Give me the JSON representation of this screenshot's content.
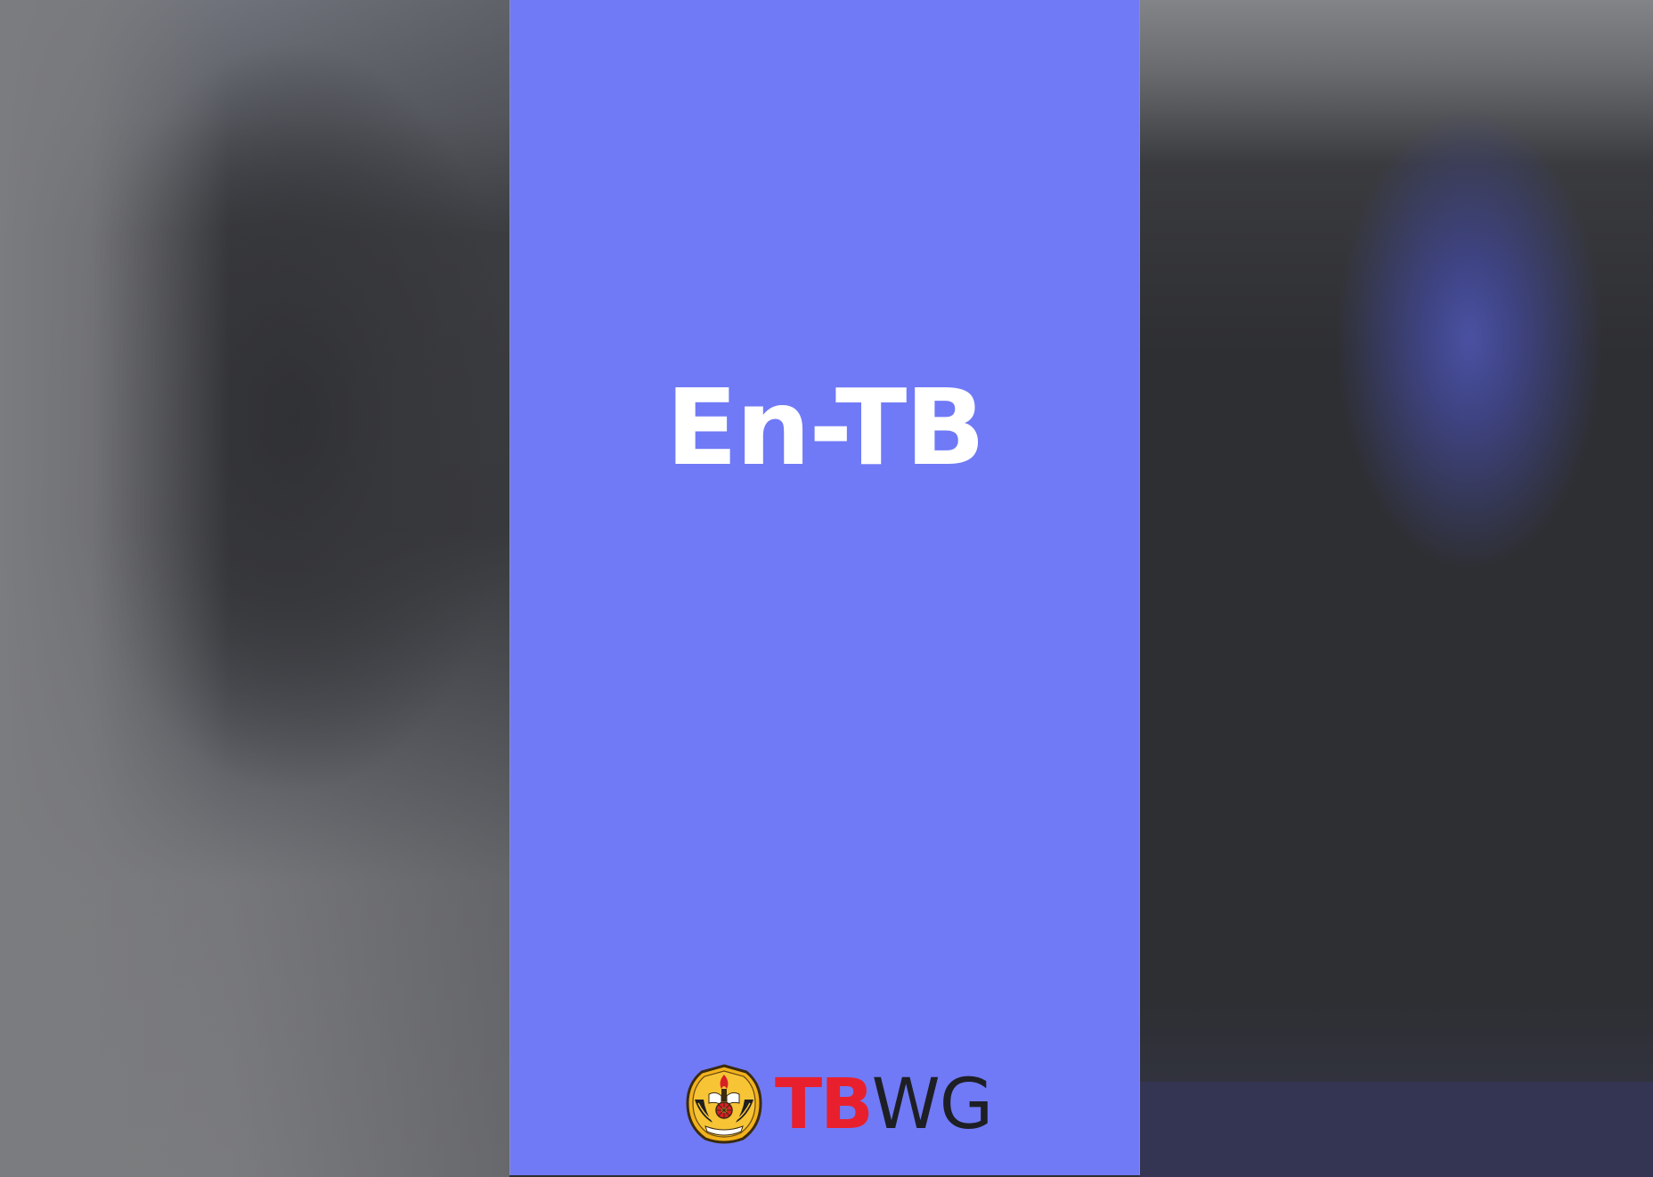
{
  "splash": {
    "title": "En-TB",
    "background_color": "#707af6",
    "title_color": "#ffffff"
  },
  "footer": {
    "emblem_icon": "university-crest-emblem",
    "brand_part1": "TB",
    "brand_part2": "WG",
    "brand_part1_color": "#e8202e",
    "brand_part2_color": "#1e1f24"
  }
}
